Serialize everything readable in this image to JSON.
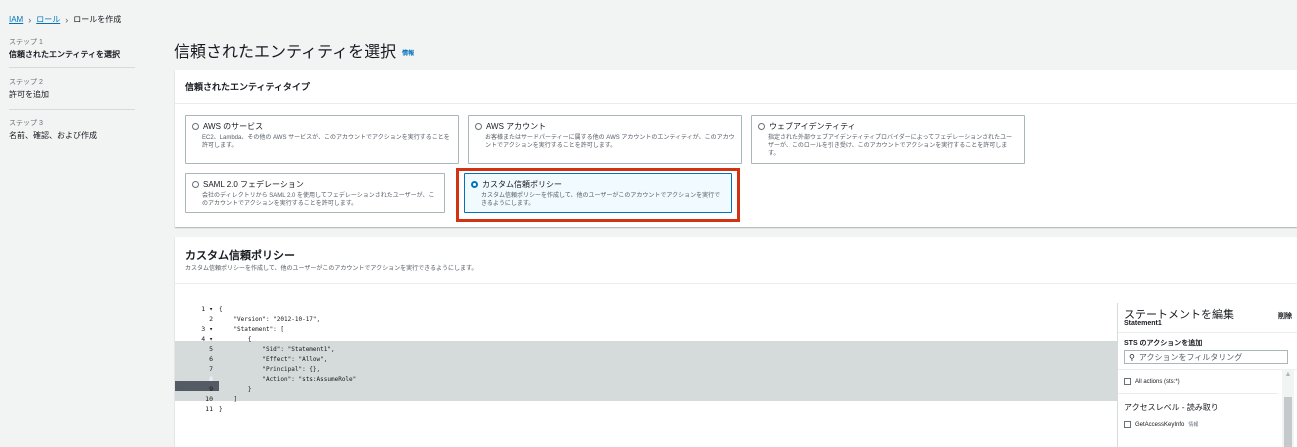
{
  "breadcrumb": {
    "iam": "IAM",
    "roles": "ロール",
    "create": "ロールを作成"
  },
  "steps": [
    {
      "num": "ステップ 1",
      "label": "信頼されたエンティティを選択"
    },
    {
      "num": "ステップ 2",
      "label": "許可を追加"
    },
    {
      "num": "ステップ 3",
      "label": "名前、確認、および作成"
    }
  ],
  "page": {
    "title": "信頼されたエンティティを選択",
    "info": "情報"
  },
  "entity_panel": {
    "header": "信頼されたエンティティタイプ",
    "options": [
      {
        "title": "AWS のサービス",
        "desc": "EC2、Lambda、その他の AWS サービスが、このアカウントでアクションを実行することを許可します。"
      },
      {
        "title": "AWS アカウント",
        "desc": "お客様またはサードパーティーに属する他の AWS アカウントのエンティティが、このアカウントでアクションを実行することを許可します。"
      },
      {
        "title": "ウェブアイデンティティ",
        "desc": "指定された外部ウェブアイデンティティプロバイダーによってフェデレーションされたユーザーが、このロールを引き受け、このアカウントでアクションを実行することを許可します。"
      },
      {
        "title": "SAML 2.0 フェデレーション",
        "desc": "会社のディレクトリから SAML 2.0 を使用してフェデレーションされたユーザーが、このアカウントでアクションを実行することを許可します。"
      },
      {
        "title": "カスタム信頼ポリシー",
        "desc": "カスタム信頼ポリシーを作成して、他のユーザーがこのアカウントでアクションを実行できるようにします。"
      }
    ],
    "selected_index": 4
  },
  "custom_policy": {
    "header": "カスタム信頼ポリシー",
    "desc": "カスタム信頼ポリシーを作成して、他のユーザーがこのアカウントでアクションを実行できるようにします。"
  },
  "editor": {
    "line_numbers": [
      "1 ▾",
      "2",
      "3 ▾",
      "4 ▾",
      "5",
      "6",
      "7",
      "8",
      "9",
      "10",
      "11"
    ],
    "lines": [
      "{",
      "    \"Version\": \"2012-10-17\",",
      "    \"Statement\": [",
      "        {",
      "            \"Sid\": \"Statement1\",",
      "            \"Effect\": \"Allow\",",
      "            \"Principal\": {},",
      "            \"Action\": \"sts:AssumeRole\"",
      "        }",
      "    ]",
      "}"
    ],
    "current_line": 8
  },
  "statement_panel": {
    "title": "ステートメントを編集",
    "subtitle": "Statement1",
    "delete": "削除",
    "add_actions": "STS のアクションを追加",
    "filter_placeholder": "アクションをフィルタリング",
    "all_actions": "All actions (sts:*)",
    "access_level": "アクセスレベル - 読み取り",
    "first_action": "GetAccessKeyInfo",
    "first_action_info": "情報"
  },
  "colors": {
    "accent": "#0073bb",
    "highlight": "#d13212",
    "selected_bg": "#f1faff"
  }
}
